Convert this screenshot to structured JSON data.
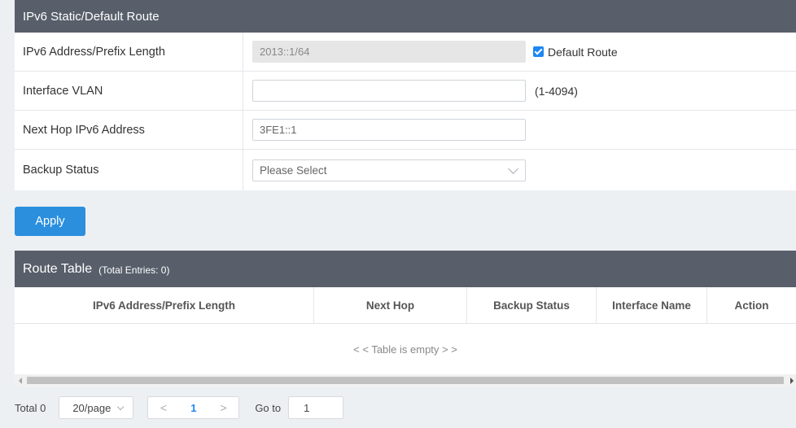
{
  "section1": {
    "title": "IPv6 Static/Default Route"
  },
  "form": {
    "ipv6_address": {
      "label": "IPv6 Address/Prefix Length",
      "value": "2013::1/64",
      "default_route_label": "Default Route",
      "default_route_checked": true
    },
    "interface_vlan": {
      "label": "Interface VLAN",
      "value": "",
      "hint": "(1-4094)"
    },
    "next_hop": {
      "label": "Next Hop IPv6 Address",
      "value": "3FE1::1"
    },
    "backup_status": {
      "label": "Backup Status",
      "selected": "Please Select"
    }
  },
  "apply_label": "Apply",
  "route_table": {
    "title": "Route Table",
    "total_entries": "(Total Entries: 0)",
    "columns": [
      "IPv6 Address/Prefix Length",
      "Next Hop",
      "Backup Status",
      "Interface Name",
      "Action"
    ],
    "empty_text": "< < Table is empty > >"
  },
  "pagination": {
    "total": "Total 0",
    "page_size": "20/page",
    "prev": "<",
    "current_page": "1",
    "next": ">",
    "goto_label": "Go to",
    "goto_value": "1"
  },
  "colors": {
    "header_bg": "#585f6a",
    "accent": "#2b8fde",
    "page_bg": "#edf0f3"
  }
}
